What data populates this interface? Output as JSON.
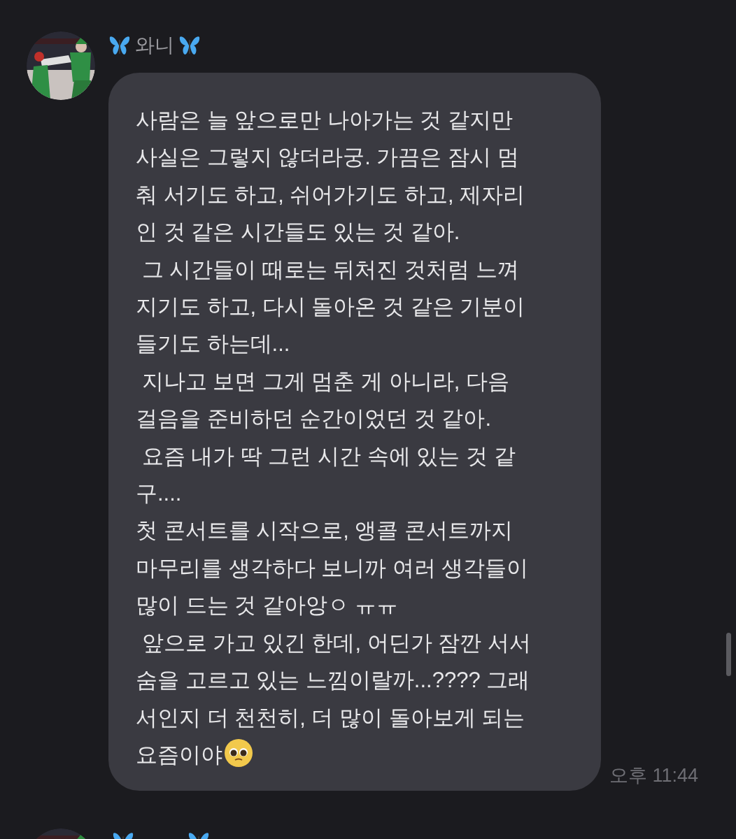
{
  "messages": [
    {
      "sender": "와니",
      "time": "오후 11:44",
      "lines": [
        "사람은 늘 앞으로만 나아가는 것 같지만",
        "사실은 그렇지 않더라궁. 가끔은 잠시 멈",
        "춰 서기도 하고, 쉬어가기도 하고, 제자리",
        "인 것 같은 시간들도 있는 것 같아.",
        " 그 시간들이 때로는 뒤처진 것처럼 느껴",
        "지기도 하고, 다시 돌아온 것 같은 기분이",
        "들기도 하는데...",
        " 지나고 보면 그게 멈춘 게 아니라, 다음",
        "걸음을 준비하던 순간이었던 것 같아.",
        " 요즘 내가 딱 그런 시간 속에 있는 것 같",
        "구....",
        "첫 콘서트를 시작으로, 앵콜 콘서트까지",
        "마무리를 생각하다 보니까 여러 생각들이",
        "많이 드는 것 같아앙ㅇ ㅠㅠ",
        " 앞으로 가고 있긴 한데, 어딘가 잠깐 서서",
        "숨을 고르고 있는 느낌이랄까...???? 그래",
        "서인지 더 천천히, 더 많이 돌아보게 되는",
        "요즘이야"
      ]
    },
    {
      "kind": "partial"
    }
  ]
}
